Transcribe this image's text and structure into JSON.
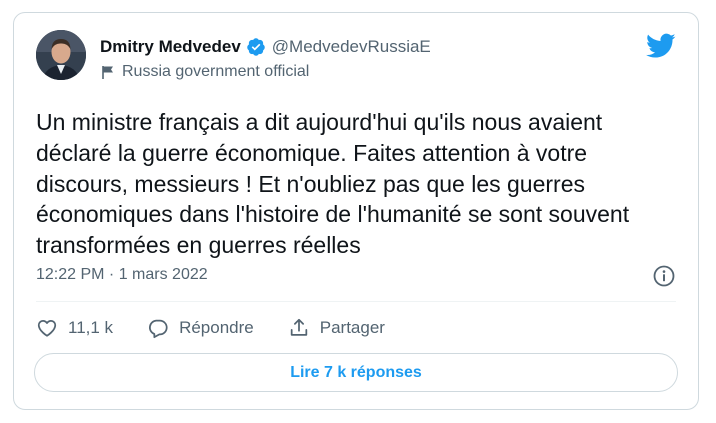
{
  "tweet": {
    "author": {
      "display_name": "Dmitry Medvedev",
      "handle": "@MedvedevRussiaE",
      "label": "Russia government official",
      "verified": true,
      "avatar_icon": "profile-photo"
    },
    "text": "Un ministre français a dit aujourd'hui qu'ils nous avaient\ndéclaré la guerre économique. Faites attention à votre\ndiscours, messieurs ! Et n'oubliez pas que les guerres\néconomiques dans l'histoire de l'humanité se sont souvent\ntransformées en guerres réelles",
    "timestamp": "12:22 PM · 1 mars 2022",
    "actions": {
      "like_count": "11,1 k",
      "reply_label": "Répondre",
      "share_label": "Partager"
    },
    "read_replies_label": "Lire 7 k réponses"
  },
  "colors": {
    "accent": "#1d9bf0",
    "text_primary": "#0f1419",
    "text_secondary": "#536471",
    "border": "#cfd9de"
  },
  "icons": {
    "brand": "twitter-bird-icon",
    "verified": "verified-badge-icon",
    "label": "flag-icon",
    "info": "info-icon",
    "like": "heart-icon",
    "reply": "reply-bubble-icon",
    "share": "share-icon"
  }
}
